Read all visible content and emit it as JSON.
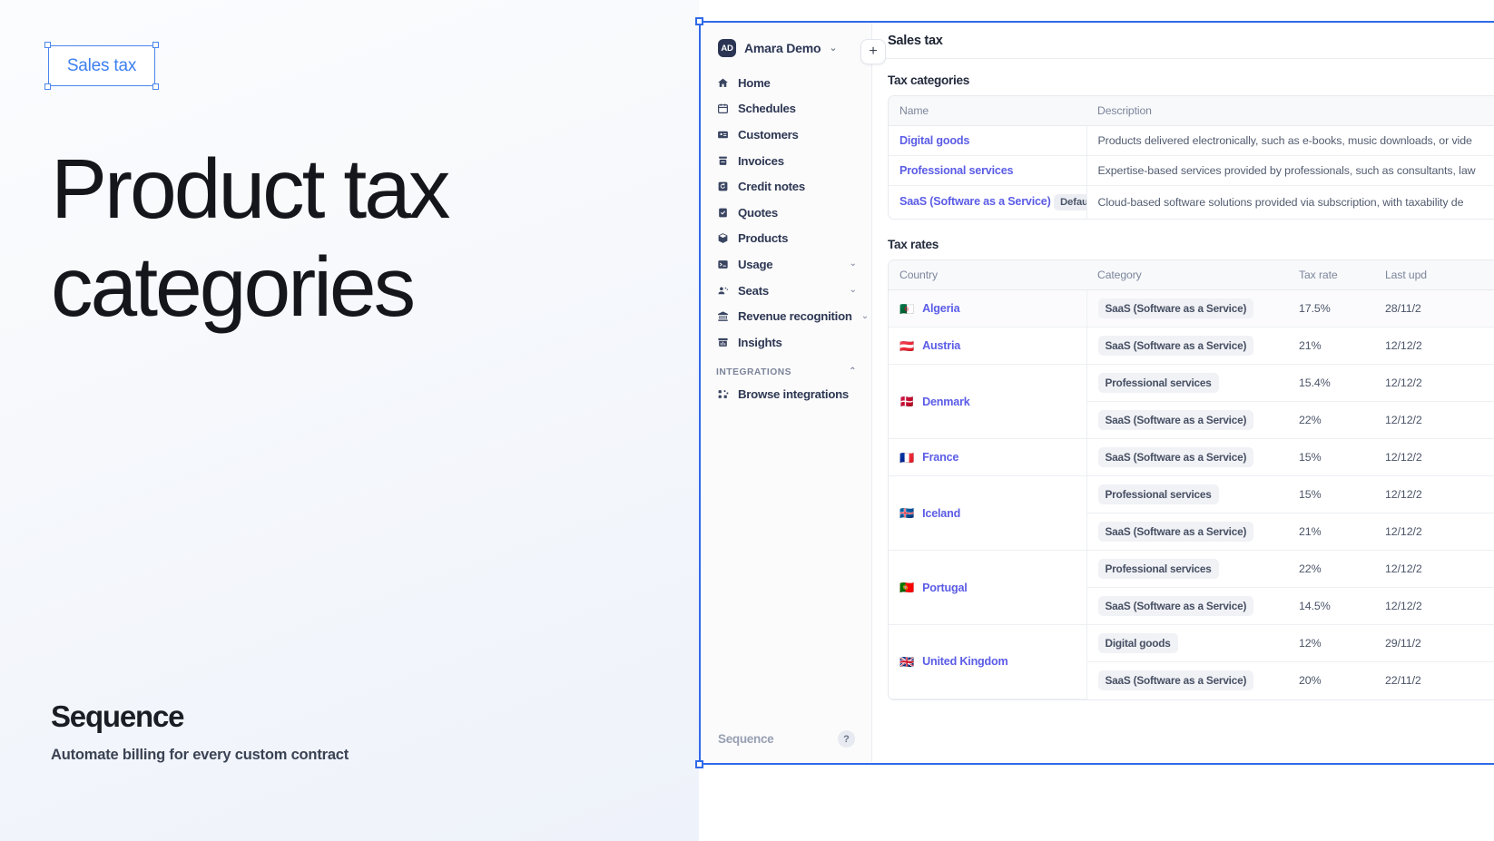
{
  "promo": {
    "selection_label": "Sales tax",
    "headline": "Product tax categories",
    "brand": "Sequence",
    "tagline": "Automate billing for every custom contract"
  },
  "app": {
    "sidebar": {
      "org": {
        "initials": "AD",
        "name": "Amara Demo",
        "caret": "⌄"
      },
      "add_button": "+",
      "nav": [
        {
          "label": "Home",
          "icon": "home-icon",
          "chevron": ""
        },
        {
          "label": "Schedules",
          "icon": "calendar-icon",
          "chevron": ""
        },
        {
          "label": "Customers",
          "icon": "id-card-icon",
          "chevron": ""
        },
        {
          "label": "Invoices",
          "icon": "invoice-icon",
          "chevron": ""
        },
        {
          "label": "Credit notes",
          "icon": "credit-note-icon",
          "chevron": ""
        },
        {
          "label": "Quotes",
          "icon": "quote-check-icon",
          "chevron": ""
        },
        {
          "label": "Products",
          "icon": "box-icon",
          "chevron": ""
        },
        {
          "label": "Usage",
          "icon": "terminal-icon",
          "chevron": "⌄"
        },
        {
          "label": "Seats",
          "icon": "people-icon",
          "chevron": "⌄"
        },
        {
          "label": "Revenue recognition",
          "icon": "bank-icon",
          "chevron": "⌄"
        },
        {
          "label": "Insights",
          "icon": "insights-icon",
          "chevron": ""
        }
      ],
      "section_label": "INTEGRATIONS",
      "section_chevron": "⌃",
      "integrations": [
        {
          "label": "Browse integrations",
          "icon": "grid-dots-icon"
        }
      ],
      "footer_brand": "Sequence",
      "help_icon": "?"
    },
    "main": {
      "title": "Sales tax",
      "categories_section": {
        "title": "Tax categories",
        "columns": [
          "Name",
          "Description"
        ],
        "rows": [
          {
            "name": "Digital goods",
            "badge": "",
            "description": "Products delivered electronically, such as e-books, music downloads, or vide"
          },
          {
            "name": "Professional services",
            "badge": "",
            "description": "Expertise-based services provided by professionals, such as consultants, law"
          },
          {
            "name": "SaaS (Software as a Service)",
            "badge": "Default",
            "description": "Cloud-based software solutions provided via subscription, with taxability de"
          }
        ]
      },
      "rates_section": {
        "title": "Tax rates",
        "columns": [
          "Country",
          "Category",
          "Tax rate",
          "Last upd"
        ],
        "groups": [
          {
            "country": "Algeria",
            "flag": "🇩🇿",
            "rows": [
              {
                "category": "SaaS (Software as a Service)",
                "rate": "17.5%",
                "updated": "28/11/2"
              }
            ]
          },
          {
            "country": "Austria",
            "flag": "🇦🇹",
            "rows": [
              {
                "category": "SaaS (Software as a Service)",
                "rate": "21%",
                "updated": "12/12/2"
              }
            ]
          },
          {
            "country": "Denmark",
            "flag": "🇩🇰",
            "rows": [
              {
                "category": "Professional services",
                "rate": "15.4%",
                "updated": "12/12/2"
              },
              {
                "category": "SaaS (Software as a Service)",
                "rate": "22%",
                "updated": "12/12/2"
              }
            ]
          },
          {
            "country": "France",
            "flag": "🇫🇷",
            "rows": [
              {
                "category": "SaaS (Software as a Service)",
                "rate": "15%",
                "updated": "12/12/2"
              }
            ]
          },
          {
            "country": "Iceland",
            "flag": "🇮🇸",
            "rows": [
              {
                "category": "Professional services",
                "rate": "15%",
                "updated": "12/12/2"
              },
              {
                "category": "SaaS (Software as a Service)",
                "rate": "21%",
                "updated": "12/12/2"
              }
            ]
          },
          {
            "country": "Portugal",
            "flag": "🇵🇹",
            "rows": [
              {
                "category": "Professional services",
                "rate": "22%",
                "updated": "12/12/2"
              },
              {
                "category": "SaaS (Software as a Service)",
                "rate": "14.5%",
                "updated": "12/12/2"
              }
            ]
          },
          {
            "country": "United Kingdom",
            "flag": "🇬🇧",
            "rows": [
              {
                "category": "Digital goods",
                "rate": "12%",
                "updated": "29/11/2"
              },
              {
                "category": "SaaS (Software as a Service)",
                "rate": "20%",
                "updated": "22/11/2"
              }
            ]
          }
        ]
      }
    }
  },
  "colors": {
    "accent_blue": "#2f6ae8",
    "link_purple": "#5b5ce6",
    "sidebar_bg": "#fbfbfc",
    "promo_bg": "#f3f6fc"
  }
}
